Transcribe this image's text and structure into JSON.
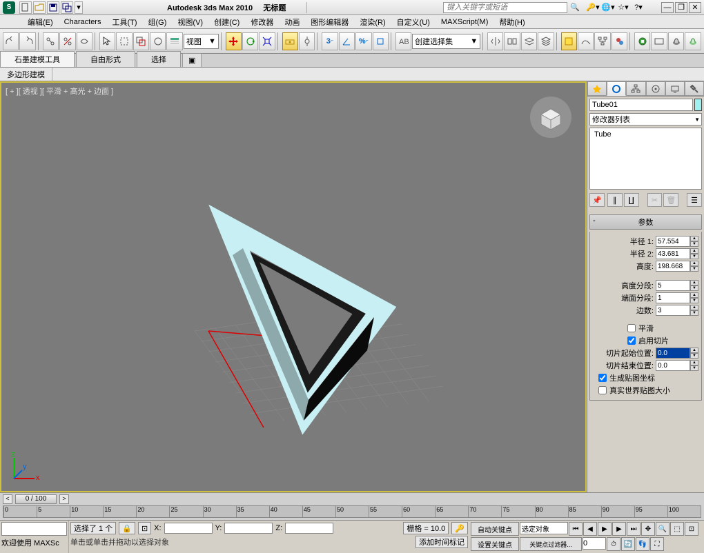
{
  "title": {
    "app": "Autodesk 3ds Max  2010",
    "doc": "无标题",
    "search_placeholder": "键入关键字或短语"
  },
  "menu": [
    "编辑(E)",
    "Characters",
    "工具(T)",
    "组(G)",
    "视图(V)",
    "创建(C)",
    "修改器",
    "动画",
    "图形编辑器",
    "渲染(R)",
    "自定义(U)",
    "MAXScript(M)",
    "帮助(H)"
  ],
  "toolbar": {
    "refsys": "视图",
    "selset": "创建选择集"
  },
  "ribbon": {
    "tabs": [
      "石墨建模工具",
      "自由形式",
      "选择"
    ],
    "sub": "多边形建模"
  },
  "viewport": {
    "label": "[ + ][ 透视 ][ 平滑 + 高光 + 边面 ]"
  },
  "panel": {
    "objname": "Tube01",
    "modlist": "修改器列表",
    "stack_item": "Tube",
    "roll_params": "参数",
    "radius1_lbl": "半径 1:",
    "radius1": "57.554",
    "radius2_lbl": "半径 2:",
    "radius2": "43.681",
    "height_lbl": "高度:",
    "height": "198.668",
    "hsegs_lbl": "高度分段:",
    "hsegs": "5",
    "csegs_lbl": "端面分段:",
    "csegs": "1",
    "sides_lbl": "边数:",
    "sides": "3",
    "smooth_lbl": "平滑",
    "slice_on_lbl": "启用切片",
    "slice_from_lbl": "切片起始位置:",
    "slice_from": "0.0",
    "slice_to_lbl": "切片结束位置:",
    "slice_to": "0.0",
    "genuv_lbl": "生成贴图坐标",
    "realworld_lbl": "真实世界贴图大小"
  },
  "timeline": {
    "pos": "0 / 100",
    "ticks": [
      "0",
      "5",
      "10",
      "15",
      "20",
      "25",
      "30",
      "35",
      "40",
      "45",
      "50",
      "55",
      "60",
      "65",
      "70",
      "75",
      "80",
      "85",
      "90",
      "95",
      "100"
    ]
  },
  "status": {
    "welcome": "欢迎使用  MAXSc",
    "selcount": "选择了 1 个",
    "hint": "单击或单击并拖动以选择对象",
    "x": "X:",
    "y": "Y:",
    "z": "Z:",
    "grid": "栅格 = 10.0",
    "addtime": "添加时间标记",
    "autokey": "自动关键点",
    "setkey": "设置关键点",
    "keyfilter": "关键点过滤器...",
    "seldrop": "选定对象"
  }
}
